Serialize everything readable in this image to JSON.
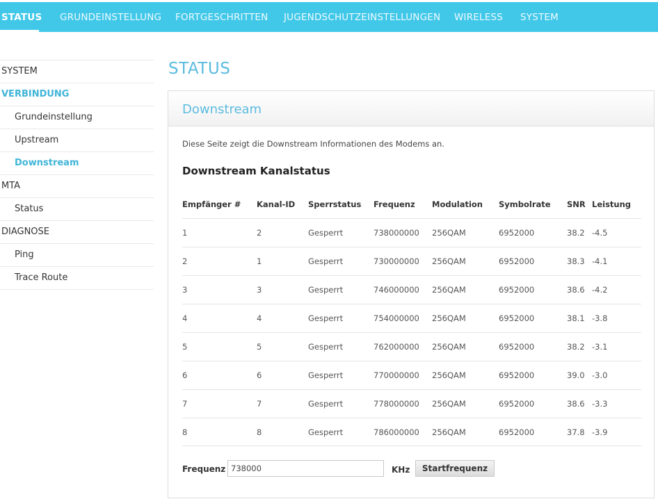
{
  "topnav": {
    "tabs": [
      {
        "label": "STATUS",
        "active": true
      },
      {
        "label": "GRUNDEINSTELLUNG",
        "active": false
      },
      {
        "label": "FORTGESCHRITTEN",
        "active": false
      },
      {
        "label": "JUGENDSCHUTZEINSTELLUNGEN",
        "active": false
      },
      {
        "label": "WIRELESS",
        "active": false
      },
      {
        "label": "SYSTEM",
        "active": false
      }
    ]
  },
  "sidebar": {
    "items": [
      {
        "label": "SYSTEM",
        "level": 0,
        "active": false
      },
      {
        "label": "VERBINDUNG",
        "level": 0,
        "active": true
      },
      {
        "label": "Grundeinstellung",
        "level": 1,
        "active": false
      },
      {
        "label": "Upstream",
        "level": 1,
        "active": false
      },
      {
        "label": "Downstream",
        "level": 1,
        "active": true
      },
      {
        "label": "MTA",
        "level": 0,
        "active": false
      },
      {
        "label": "Status",
        "level": 1,
        "active": false
      },
      {
        "label": "DIAGNOSE",
        "level": 0,
        "active": false
      },
      {
        "label": "Ping",
        "level": 1,
        "active": false
      },
      {
        "label": "Trace Route",
        "level": 1,
        "active": false
      }
    ]
  },
  "page": {
    "title": "STATUS"
  },
  "panel": {
    "title": "Downstream",
    "description": "Diese Seite zeigt die Downstream Informationen des Modems an.",
    "section_title": "Downstream Kanalstatus"
  },
  "table": {
    "headers": [
      "Empfänger #",
      "Kanal-ID",
      "Sperrstatus",
      "Frequenz",
      "Modulation",
      "Symbolrate",
      "SNR",
      "Leistung"
    ],
    "rows": [
      [
        "1",
        "2",
        "Gesperrt",
        "738000000",
        "256QAM",
        "6952000",
        "38.2",
        "-4.5"
      ],
      [
        "2",
        "1",
        "Gesperrt",
        "730000000",
        "256QAM",
        "6952000",
        "38.3",
        "-4.1"
      ],
      [
        "3",
        "3",
        "Gesperrt",
        "746000000",
        "256QAM",
        "6952000",
        "38.6",
        "-4.2"
      ],
      [
        "4",
        "4",
        "Gesperrt",
        "754000000",
        "256QAM",
        "6952000",
        "38.1",
        "-3.8"
      ],
      [
        "5",
        "5",
        "Gesperrt",
        "762000000",
        "256QAM",
        "6952000",
        "38.2",
        "-3.1"
      ],
      [
        "6",
        "6",
        "Gesperrt",
        "770000000",
        "256QAM",
        "6952000",
        "39.0",
        "-3.0"
      ],
      [
        "7",
        "7",
        "Gesperrt",
        "778000000",
        "256QAM",
        "6952000",
        "38.6",
        "-3.3"
      ],
      [
        "8",
        "8",
        "Gesperrt",
        "786000000",
        "256QAM",
        "6952000",
        "37.8",
        "-3.9"
      ]
    ]
  },
  "frequency_form": {
    "label": "Frequenz",
    "value": "738000",
    "unit": "KHz",
    "button_label": "Startfrequenz"
  },
  "colors": {
    "nav_bar": "#41c8e9",
    "accent_text": "#5bbbdf",
    "active_sidebar": "#3fb4d8"
  }
}
